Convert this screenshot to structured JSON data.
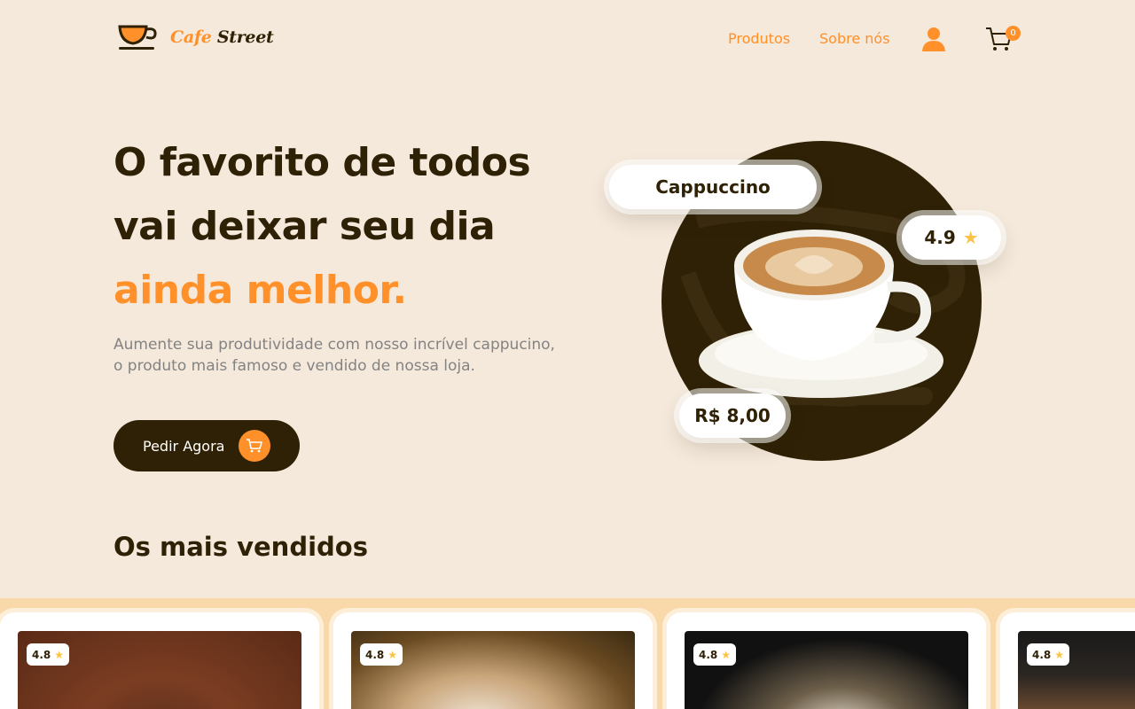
{
  "nav": {
    "logo_text_1": "Cafe",
    "logo_text_2": "Street",
    "links": [
      "Produtos",
      "Sobre nós"
    ],
    "cart_count": "0"
  },
  "hero": {
    "title_line1": "O favorito de todos",
    "title_line2": "vai deixar seu dia",
    "title_highlight": "ainda melhor.",
    "description": "Aumente sua produtividade com nosso incrível cappucino, o produto mais famoso e vendido de nossa loja.",
    "cta_label": "Pedir Agora",
    "product_name": "Cappuccino",
    "product_rating": "4.9",
    "product_price": "R$ 8,00"
  },
  "bestsellers": {
    "title": "Os mais vendidos",
    "cards": [
      {
        "rating": "4.8"
      },
      {
        "rating": "4.8"
      },
      {
        "rating": "4.8"
      },
      {
        "rating": "4.8"
      }
    ]
  },
  "colors": {
    "background": "#f5e9dc",
    "accent": "#ff902a",
    "dark": "#2f2105",
    "band": "#f9d9aa"
  }
}
